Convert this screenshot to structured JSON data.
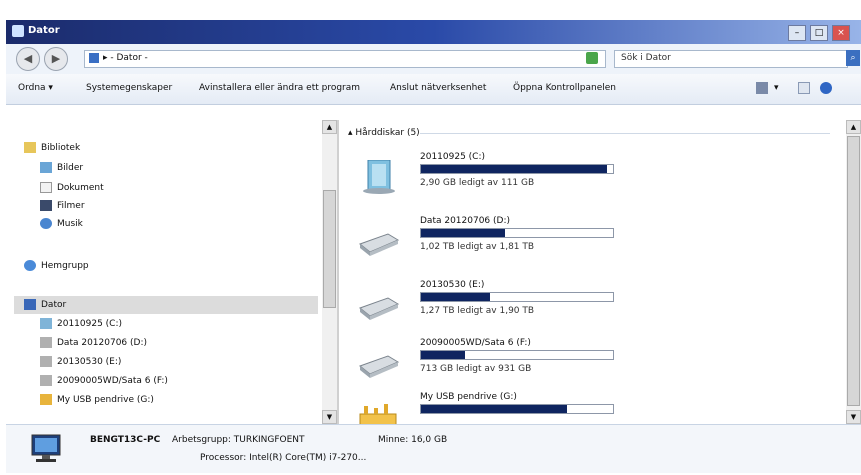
{
  "window": {
    "title": "Dator"
  },
  "window_controls": {
    "minimize": "–",
    "maximize": "□",
    "close": "×"
  },
  "address": {
    "path": "▸ - Dator -",
    "dropdown": "▾"
  },
  "search": {
    "placeholder": "Sök i Dator"
  },
  "toolbar": {
    "organize": "Ordna ▾",
    "system_properties": "Systemegenskaper",
    "uninstall": "Avinstallera eller ändra ett program",
    "map_drive": "Anslut nätverksenhet",
    "control_panel": "Öppna Kontrollpanelen",
    "view_dropdown": "▾"
  },
  "sidebar": {
    "items": [
      {
        "label": "Bibliotek",
        "icon": "library-icon"
      },
      {
        "label": "Bilder",
        "icon": "pictures-icon"
      },
      {
        "label": "Dokument",
        "icon": "documents-icon"
      },
      {
        "label": "Filmer",
        "icon": "videos-icon"
      },
      {
        "label": "Musik",
        "icon": "music-icon"
      },
      {
        "label": "Hemgrupp",
        "icon": "homegroup-icon"
      },
      {
        "label": "Dator",
        "icon": "computer-icon"
      },
      {
        "label": "20110925 (C:)",
        "icon": "drive-icon"
      },
      {
        "label": "Data 20120706 (D:)",
        "icon": "drive-icon"
      },
      {
        "label": "20130530 (E:)",
        "icon": "drive-icon"
      },
      {
        "label": "20090005WD/Sata 6 (F:)",
        "icon": "drive-icon"
      },
      {
        "label": "My USB pendrive (G:)",
        "icon": "usb-icon"
      }
    ]
  },
  "main": {
    "group_header": "▴ Hårddiskar (5)",
    "drives": [
      {
        "name": "20110925 (C:)",
        "free": "2,90 GB ledigt av 111 GB",
        "used_fraction": 0.97,
        "icon": "system-drive-icon"
      },
      {
        "name": "Data 20120706 (D:)",
        "free": "1,02 TB ledigt av 1,81 TB",
        "used_fraction": 0.44,
        "icon": "hard-drive-icon"
      },
      {
        "name": "20130530 (E:)",
        "free": "1,27 TB ledigt av 1,90 TB",
        "used_fraction": 0.36,
        "icon": "hard-drive-icon"
      },
      {
        "name": "20090005WD/Sata 6 (F:)",
        "free": "713 GB ledigt av 931 GB",
        "used_fraction": 0.23,
        "icon": "hard-drive-icon"
      },
      {
        "name": "My USB pendrive (G:)",
        "free": "",
        "used_fraction": 0.76,
        "icon": "usb-drive-icon"
      }
    ]
  },
  "details": {
    "computer_name": "BENGT13C-PC",
    "workgroup": "Arbetsgrupp: TURKINGFOENT",
    "memory": "Minne: 16,0 GB",
    "processor": "Processor: Intel(R) Core(TM) i7-270..."
  },
  "colors": {
    "bar_fill": "#0f2560",
    "title_bar": "#2a4aa8"
  }
}
